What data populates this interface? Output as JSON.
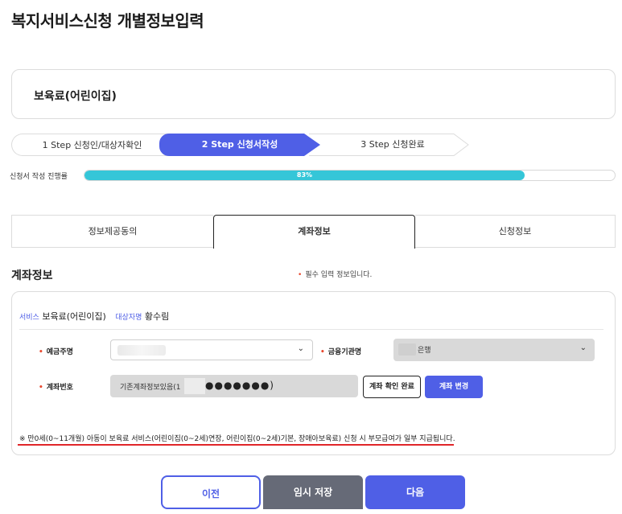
{
  "page": {
    "title": "복지서비스신청 개별정보입력"
  },
  "service": {
    "name": "보육료(어린이집)"
  },
  "steps": [
    {
      "label": "1 Step 신청인/대상자확인"
    },
    {
      "label": "2 Step 신청서작성"
    },
    {
      "label": "3 Step 신청완료"
    }
  ],
  "progress": {
    "label": "신청서 작성 진행률",
    "value_text": "83%",
    "percent": 83
  },
  "tabs": [
    {
      "label": "정보제공동의"
    },
    {
      "label": "계좌정보"
    },
    {
      "label": "신청정보"
    }
  ],
  "section": {
    "title": "계좌정보",
    "required_note": "필수 입력 정보입니다.",
    "required_mark": "•"
  },
  "form": {
    "service_label": "서비스",
    "service_value": "보육료(어린이집)",
    "target_label": "대상자명",
    "target_value": "황수림",
    "depositor_label": "예금주명",
    "bank_label": "금융기관명",
    "bank_value": "은행",
    "account_label": "계좌번호",
    "account_text": "기존계좌정보있음(1",
    "account_masked": "●●●●●●●)",
    "confirm_button": "계좌 확인 완료",
    "change_button": "계좌 변경",
    "chevron_icon": "chevron-down-icon"
  },
  "notice": "※ 만0세(0~11개월) 아동이 보육료 서비스(어린이집(0~2세)연장, 어린이집(0~2세)기본, 장애아보육료) 신청 시 부모급여가 일부 지급됩니다.",
  "buttons": {
    "prev": "이전",
    "save": "임시 저장",
    "next": "다음"
  },
  "colors": {
    "accent": "#4f5fe6",
    "progress": "#35c6d8",
    "required": "#e8492f",
    "underline": "#e0262a",
    "save_button": "#666a77"
  }
}
